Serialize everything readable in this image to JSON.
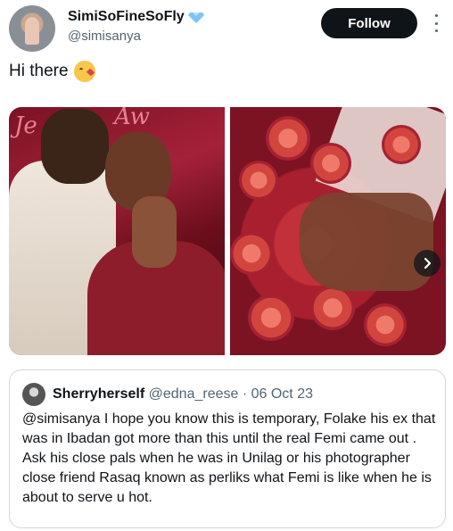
{
  "author": {
    "display_name": "SimiSoFineSoFly",
    "handle": "@simisanya",
    "verified_icon": "verified-badge-icon",
    "avatar": "profile-avatar"
  },
  "actions": {
    "follow_label": "Follow",
    "more_icon": "more-options-icon"
  },
  "tweet": {
    "text": "Hi there",
    "emoji": "face-blowing-kiss-emoji"
  },
  "media": {
    "photos": [
      "engagement-couple-photo",
      "rose-bouquet-ring-photo"
    ],
    "next_icon": "chevron-right-icon"
  },
  "quote": {
    "name": "Sherryherself",
    "handle": "@edna_reese",
    "separator": " · ",
    "date": "06 Oct 23",
    "body": "@simisanya  I hope you know this is temporary, Folake his ex that was in Ibadan got more than this until the real Femi came out .  Ask his close pals when he was in Unilag or his photographer close friend Rasaq known as perliks what Femi is like when he is about to serve u hot."
  },
  "colors": {
    "text_primary": "#0f1419",
    "text_secondary": "#536471",
    "follow_bg": "#0f1419",
    "verified": "#7ec4f5",
    "border": "#cfd9de"
  }
}
